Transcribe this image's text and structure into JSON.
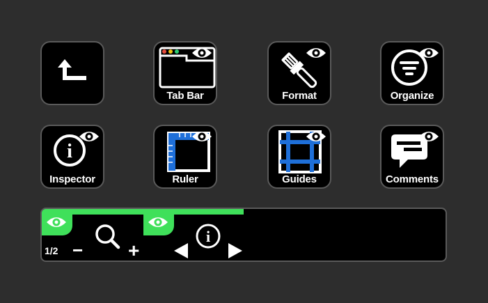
{
  "keys": {
    "back": {
      "icon": "back-arrow-icon"
    },
    "tab_bar": {
      "label": "Tab Bar",
      "icon": "browser-window-icon"
    },
    "format": {
      "label": "Format",
      "icon": "paintbrush-icon"
    },
    "organize": {
      "label": "Organize",
      "icon": "organize-icon"
    },
    "inspector": {
      "label": "Inspector",
      "icon": "info-icon"
    },
    "ruler": {
      "label": "Ruler",
      "icon": "ruler-icon"
    },
    "guides": {
      "label": "Guides",
      "icon": "guides-icon"
    },
    "comments": {
      "label": "Comments",
      "icon": "comment-icon"
    }
  },
  "bar": {
    "page_indicator": "1/2",
    "progress": 0.5,
    "zoom_out": "−",
    "zoom_in": "+"
  },
  "colors": {
    "accent_green": "#3fe05a",
    "guide_blue": "#1e6fd9",
    "key_bg": "#000000",
    "key_border": "#5a5a5a"
  }
}
